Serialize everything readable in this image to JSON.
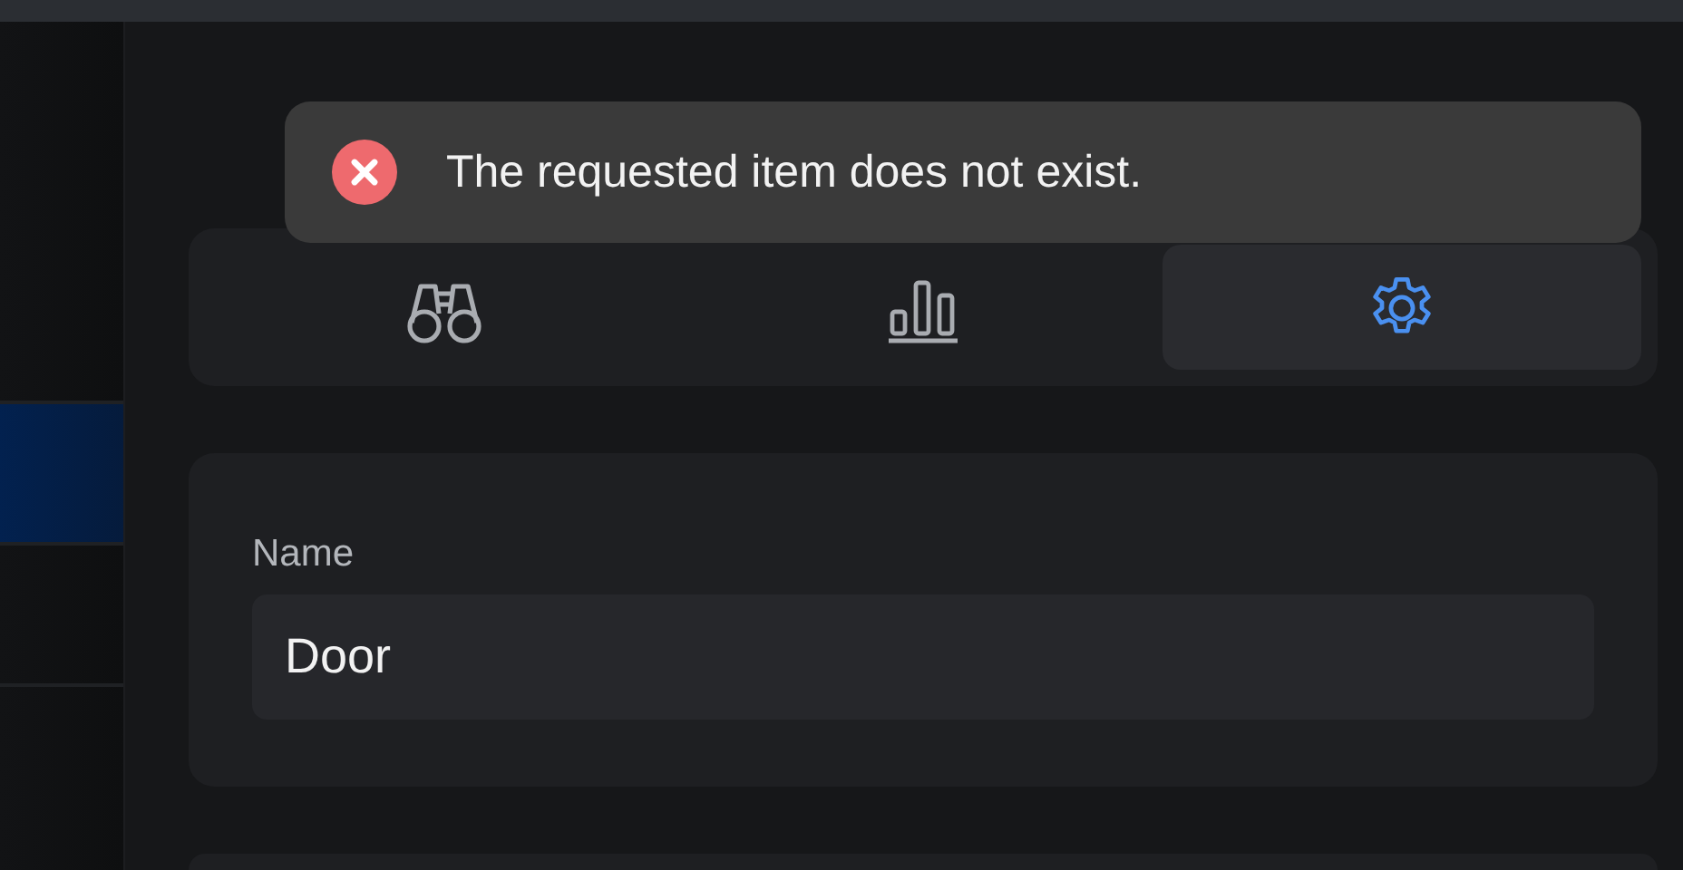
{
  "sidebar": {
    "items": [
      {
        "selected": true
      },
      {
        "selected": false
      }
    ]
  },
  "tabs": [
    {
      "selected": false
    },
    {
      "selected": false
    },
    {
      "selected": true
    }
  ],
  "form": {
    "label": "Name",
    "value": "Door"
  },
  "toast": {
    "kind": "error",
    "message": "The requested item does not exist."
  }
}
